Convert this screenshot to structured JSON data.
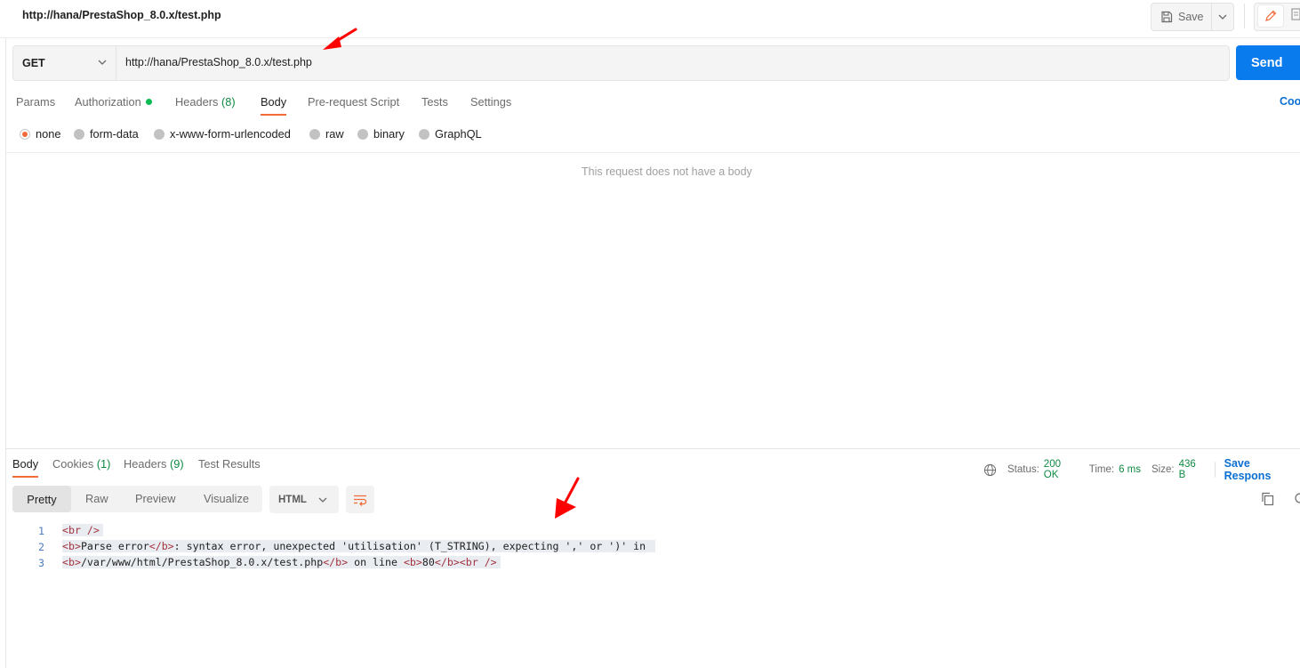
{
  "header": {
    "tab_title": "http://hana/PrestaShop_8.0.x/test.php",
    "save_label": "Save",
    "edit_icon": "pencil-icon",
    "doc_icon": "document-icon"
  },
  "request": {
    "method": "GET",
    "url": "http://hana/PrestaShop_8.0.x/test.php",
    "send_label": "Send",
    "tabs": [
      {
        "label": "Params"
      },
      {
        "label": "Authorization"
      },
      {
        "label": "Headers",
        "count": "(8)"
      },
      {
        "label": "Body"
      },
      {
        "label": "Pre-request Script"
      },
      {
        "label": "Tests"
      },
      {
        "label": "Settings"
      }
    ],
    "active_tab": "Body",
    "cookies_link": "Coo",
    "body_types": [
      "none",
      "form-data",
      "x-www-form-urlencoded",
      "raw",
      "binary",
      "GraphQL"
    ],
    "selected_body_type": "none",
    "empty_body_text": "This request does not have a body"
  },
  "response": {
    "tabs": [
      {
        "label": "Body"
      },
      {
        "label": "Cookies",
        "count": "(1)"
      },
      {
        "label": "Headers",
        "count": "(9)"
      },
      {
        "label": "Test Results"
      }
    ],
    "active_tab": "Body",
    "status_label": "Status:",
    "status_value": "200 OK",
    "time_label": "Time:",
    "time_value": "6 ms",
    "size_label": "Size:",
    "size_value": "436 B",
    "save_response_label": "Save Respons",
    "view_modes": [
      "Pretty",
      "Raw",
      "Preview",
      "Visualize"
    ],
    "active_view": "Pretty",
    "language": "HTML",
    "lines": [
      {
        "num": "1",
        "text": "<br />"
      },
      {
        "num": "2",
        "text": "<b>Parse error</b>: syntax error, unexpected 'utilisation' (T_STRING), expecting ',' or ')' in"
      },
      {
        "num": "3",
        "text": "<b>/var/www/html/PrestaShop_8.0.x/test.php</b> on line <b>80</b><br />"
      }
    ]
  },
  "colors": {
    "accent": "#f26b3a",
    "send": "#097bed",
    "link": "#0b6fd2",
    "success": "#0f8a43",
    "annotation_arrow": "#ff0000"
  }
}
